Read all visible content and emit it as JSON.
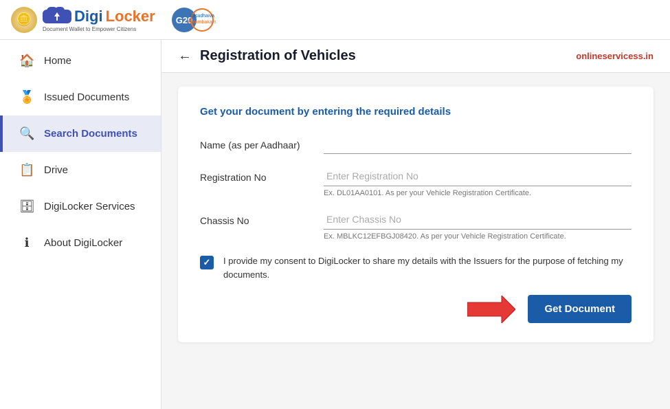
{
  "header": {
    "logo_brand": "DigiLocker",
    "logo_digi": "Digi",
    "logo_locker": "Locker",
    "tagline": "Document Wallet to Empower Citizens",
    "topbar_link": "onlineservicess.in"
  },
  "sidebar": {
    "items": [
      {
        "id": "home",
        "label": "Home",
        "icon": "🏠",
        "active": false
      },
      {
        "id": "issued-documents",
        "label": "Issued Documents",
        "icon": "🏅",
        "active": false
      },
      {
        "id": "search-documents",
        "label": "Search Documents",
        "icon": "🔍",
        "active": true
      },
      {
        "id": "drive",
        "label": "Drive",
        "icon": "📋",
        "active": false
      },
      {
        "id": "digilocker-services",
        "label": "DigiLocker Services",
        "icon": "🗄",
        "active": false
      },
      {
        "id": "about-digilocker",
        "label": "About DigiLocker",
        "icon": "ℹ",
        "active": false
      }
    ]
  },
  "topbar": {
    "back_label": "←",
    "page_title": "Registration of Vehicles",
    "external_link": "onlineservicess.in"
  },
  "form": {
    "subtitle": "Get your document by entering the required details",
    "fields": [
      {
        "label": "Name (as per Aadhaar)",
        "placeholder": "",
        "hint": ""
      },
      {
        "label": "Registration No",
        "placeholder": "Enter Registration No",
        "hint": "Ex. DL01AA0101. As per your Vehicle Registration Certificate."
      },
      {
        "label": "Chassis No",
        "placeholder": "Enter Chassis No",
        "hint": "Ex. MBLKC12EFBGJ08420. As per your Vehicle Registration Certificate."
      }
    ],
    "consent_text": "I provide my consent to DigiLocker to share my details with the Issuers for the purpose of fetching my documents.",
    "get_document_btn": "Get Document"
  }
}
